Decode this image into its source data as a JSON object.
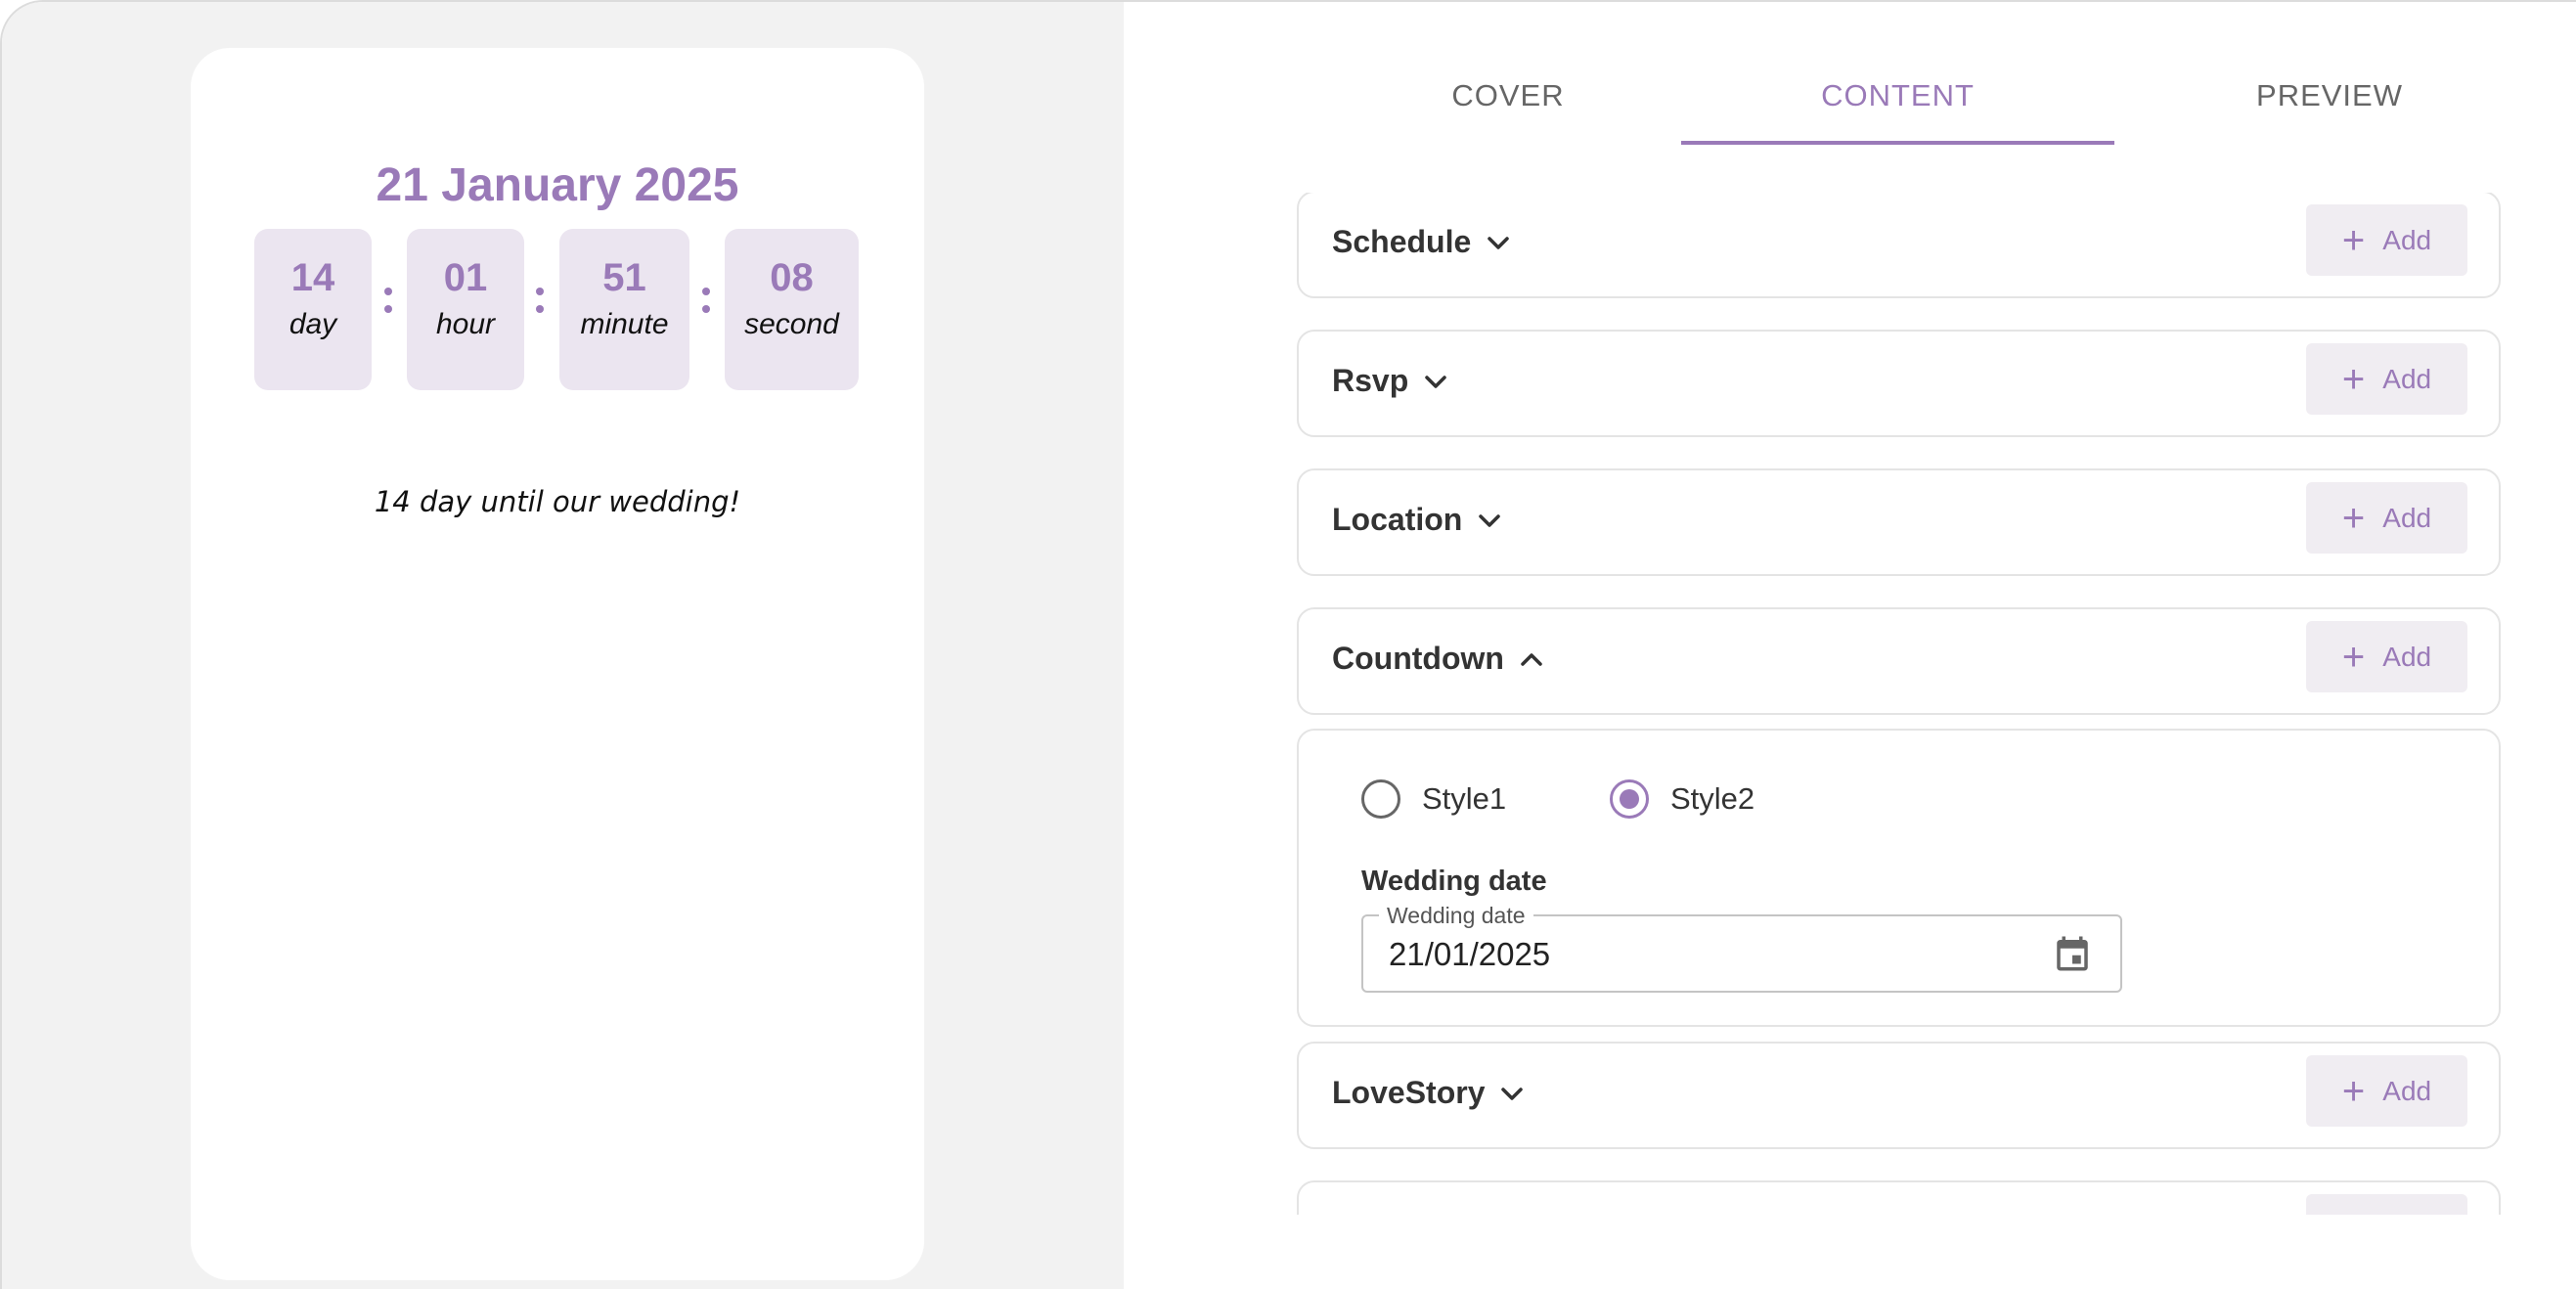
{
  "preview": {
    "date_title": "21 January 2025",
    "countdown": [
      {
        "value": "14",
        "unit": "day"
      },
      {
        "value": "01",
        "unit": "hour"
      },
      {
        "value": "51",
        "unit": "minute"
      },
      {
        "value": "08",
        "unit": "second"
      }
    ],
    "until_text": "14 day until our wedding!"
  },
  "tabs": [
    {
      "label": "COVER",
      "active": false
    },
    {
      "label": "CONTENT",
      "active": true
    },
    {
      "label": "PREVIEW",
      "active": false
    }
  ],
  "sections": [
    {
      "title": "Schedule",
      "expanded": false,
      "add_label": "Add"
    },
    {
      "title": "Rsvp",
      "expanded": false,
      "add_label": "Add"
    },
    {
      "title": "Location",
      "expanded": false,
      "add_label": "Add"
    },
    {
      "title": "Countdown",
      "expanded": true,
      "add_label": "Add"
    },
    {
      "title": "LoveStory",
      "expanded": false,
      "add_label": "Add"
    }
  ],
  "countdown_settings": {
    "styles": [
      {
        "label": "Style1",
        "selected": false
      },
      {
        "label": "Style2",
        "selected": true
      }
    ],
    "field_heading": "Wedding date",
    "field_label": "Wedding date",
    "field_value": "21/01/2025"
  },
  "colors": {
    "accent": "#9a7ab8",
    "tile_bg": "#ebe5f0",
    "add_bg": "#f0edf2",
    "left_bg": "#f2f2f2"
  }
}
